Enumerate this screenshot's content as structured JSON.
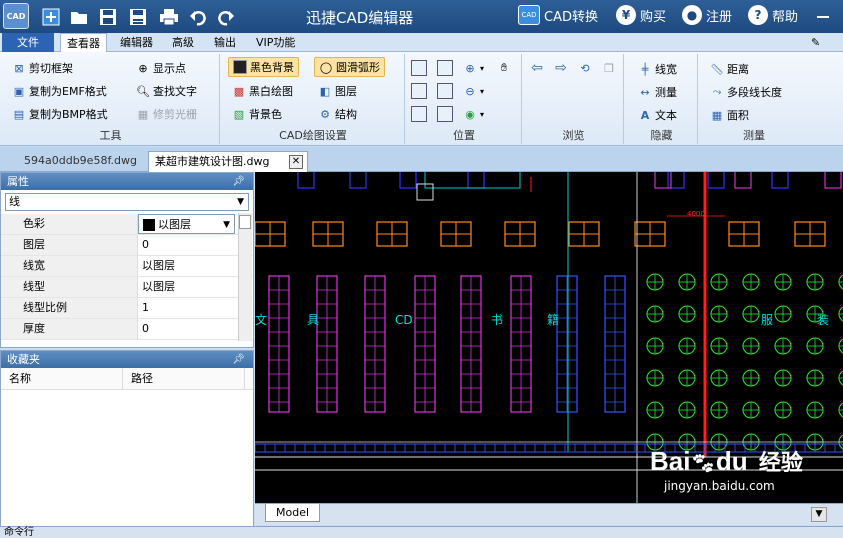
{
  "app": {
    "title": "迅捷CAD编辑器",
    "logo_text": "CAD",
    "accent": "#2c64b3",
    "quick_access_icons": [
      "new-icon",
      "open-icon",
      "save-icon",
      "save-as-icon",
      "print-icon",
      "undo-icon",
      "redo-icon"
    ]
  },
  "title_actions": {
    "convert": {
      "icon": "cad-convert-icon",
      "label": "CAD转换"
    },
    "buy": {
      "icon": "yen-icon",
      "label": "购买"
    },
    "register": {
      "icon": "user-icon",
      "label": "注册"
    },
    "help": {
      "icon": "question-icon",
      "label": "帮助"
    }
  },
  "menu": {
    "file": "文件",
    "tabs": [
      "查看器",
      "编辑器",
      "高级",
      "输出",
      "VIP功能"
    ]
  },
  "ribbon": {
    "tools": {
      "label": "工具",
      "items": [
        "剪切框架",
        "显示点",
        "复制为EMF格式",
        "查找文字",
        "复制为BMP格式",
        "修剪光栅"
      ]
    },
    "draw_settings": {
      "label": "CAD绘图设置",
      "items": [
        "黑色背景",
        "圆滑弧形",
        "黑白绘图",
        "图层",
        "背景色",
        "结构"
      ]
    },
    "position": {
      "label": "位置"
    },
    "browse": {
      "label": "浏览"
    },
    "hide": {
      "label": "隐藏",
      "items": [
        "线宽",
        "测量",
        "文本"
      ]
    },
    "measure": {
      "label": "测量",
      "items": [
        "距离",
        "多段线长度",
        "面积"
      ]
    }
  },
  "doc_tabs": [
    "594a0ddb9e58f.dwg",
    "某超市建筑设计图.dwg"
  ],
  "properties": {
    "title": "属性",
    "selected": "线",
    "rows": [
      {
        "key": "色彩",
        "value": "以图层"
      },
      {
        "key": "图层",
        "value": "0"
      },
      {
        "key": "线宽",
        "value": "以图层"
      },
      {
        "key": "线型",
        "value": "以图层"
      },
      {
        "key": "线型比例",
        "value": "1"
      },
      {
        "key": "厚度",
        "value": "0"
      }
    ]
  },
  "favorites": {
    "title": "收藏夹",
    "columns": [
      "名称",
      "路径"
    ]
  },
  "canvas": {
    "labels": [
      "文",
      "具",
      "CD",
      "书",
      "籍",
      "服",
      "装"
    ],
    "dimension": "4000",
    "model_tab": "Model"
  },
  "command_line": "命令行",
  "watermark": {
    "brand": "Bai",
    "brand_suffix": "du",
    "cn": "经验",
    "url": "jingyan.baidu.com"
  }
}
